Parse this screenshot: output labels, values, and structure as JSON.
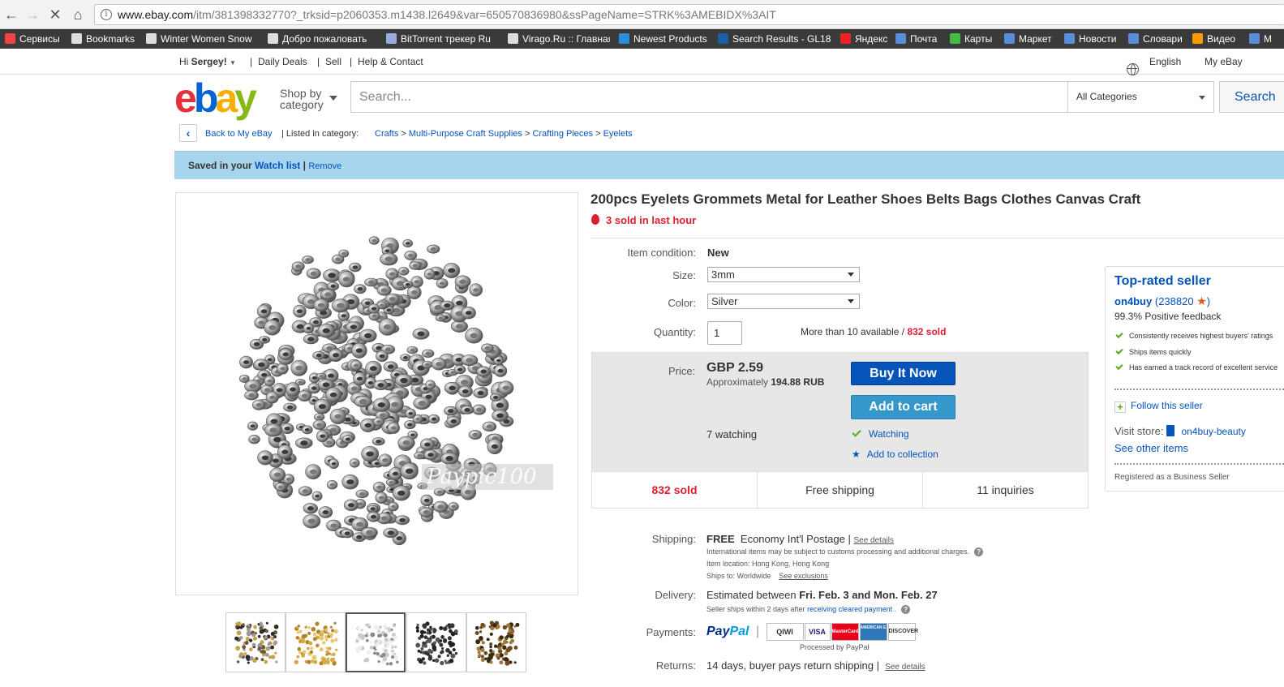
{
  "browser": {
    "url_host": "www.ebay.com",
    "url_path": "/itm/381398332770?_trksid=p2060353.m1438.l2649&var=650570836980&ssPageName=STRK%3AMEBIDX%3AIT",
    "bookmarks": [
      {
        "label": "Сервисы",
        "icon_color": "#e44"
      },
      {
        "label": "Bookmarks",
        "icon_color": "#ddd"
      },
      {
        "label": "Winter Women Snow",
        "icon_color": "#ddd"
      },
      {
        "label": "Добро пожаловать",
        "icon_color": "#ddd"
      },
      {
        "label": "BitTorrent трекер Ru",
        "icon_color": "#9ad"
      },
      {
        "label": "Virago.Ru :: Главная",
        "icon_color": "#ddd"
      },
      {
        "label": "Newest Products",
        "icon_color": "#2a8fd8"
      },
      {
        "label": "Search Results - GL18",
        "icon_color": "#1a5fa8"
      },
      {
        "label": "Яндекс",
        "icon_color": "#e22"
      },
      {
        "label": "Почта",
        "icon_color": "#5a8dd8"
      },
      {
        "label": "Карты",
        "icon_color": "#4b4"
      },
      {
        "label": "Маркет",
        "icon_color": "#5a8dd8"
      },
      {
        "label": "Новости",
        "icon_color": "#5a8dd8"
      },
      {
        "label": "Словари",
        "icon_color": "#5a8dd8"
      },
      {
        "label": "Видео",
        "icon_color": "#f90"
      },
      {
        "label": "М",
        "icon_color": "#5a8dd8"
      }
    ]
  },
  "topnav": {
    "greeting_prefix": "Hi ",
    "user": "Sergey!",
    "daily_deals": "Daily Deals",
    "sell": "Sell",
    "help": "Help & Contact",
    "language": "English",
    "my_ebay": "My eBay"
  },
  "header": {
    "logo": {
      "e": "e",
      "b": "b",
      "a": "a",
      "y": "y"
    },
    "shop_by_line1": "Shop by",
    "shop_by_line2": "category",
    "search_placeholder": "Search...",
    "category": "All Categories",
    "search_button": "Search"
  },
  "breadcrumb": {
    "back": "Back to My eBay",
    "listed": "Listed in category:",
    "crumbs": [
      "Crafts",
      "Multi-Purpose Craft Supplies",
      "Crafting Pieces",
      "Eyelets"
    ]
  },
  "watch_banner": {
    "prefix": "Saved in your ",
    "watch_list": "Watch list",
    "remove": "Remove"
  },
  "gallery": {
    "watermark": "Paypic100",
    "thumbnails": [
      "mixed-colors",
      "gold",
      "silver",
      "black",
      "bronze"
    ],
    "selected_index": 2
  },
  "item": {
    "title": "200pcs Eyelets Grommets Metal for Leather Shoes Belts Bags Clothes Canvas Craft",
    "hot": "3 sold in last hour",
    "condition_label": "Item condition:",
    "condition": "New",
    "size_label": "Size:",
    "size": "3mm",
    "color_label": "Color:",
    "color": "Silver",
    "quantity_label": "Quantity:",
    "quantity": "1",
    "available": "More than 10 available",
    "sold_count": "832 sold",
    "price_label": "Price:",
    "price": "GBP 2.59",
    "approx_prefix": "Approximately",
    "approx_value": "194.88 RUB",
    "buy_now": "Buy It Now",
    "add_to_cart": "Add to cart",
    "watching_count": "7 watching",
    "watching": "Watching",
    "add_collection": "Add to collection",
    "stats": [
      "832 sold",
      "Free shipping",
      "11 inquiries"
    ]
  },
  "seller": {
    "heading": "Top-rated seller",
    "name": "on4buy",
    "score": "238820",
    "feedback": "99.3% Positive feedback",
    "points": [
      "Consistently receives highest buyers' ratings",
      "Ships items quickly",
      "Has earned a track record of excellent service"
    ],
    "follow": "Follow this seller",
    "visit_store": "Visit store:",
    "store": "on4buy-beauty",
    "see_other": "See other items",
    "registered": "Registered as a Business Seller"
  },
  "shipping": {
    "shipping_label": "Shipping:",
    "free": "FREE",
    "method": "Economy Int'l Postage",
    "see_details": "See details",
    "intl_note": "International items may be subject to customs processing and additional charges.",
    "location": "Item location:  Hong Kong, Hong Kong",
    "ships_to": "Ships to:  Worldwide",
    "see_exclusions": "See exclusions",
    "delivery_label": "Delivery:",
    "delivery_prefix": "Estimated between",
    "delivery_dates": "Fri. Feb. 3 and Mon. Feb. 27",
    "ships_within": "Seller ships within 2 days after",
    "cleared": "receiving cleared payment",
    "payments_label": "Payments:",
    "paypal_a": "Pay",
    "paypal_b": "Pal",
    "cards": [
      "QIWI",
      "VISA",
      "MasterCard",
      "AMERICAN EXPRESS",
      "DISCOVER"
    ],
    "processed": "Processed by PayPal",
    "returns_label": "Returns:",
    "returns": "14 days, buyer pays return shipping |",
    "returns_details": "See details"
  }
}
